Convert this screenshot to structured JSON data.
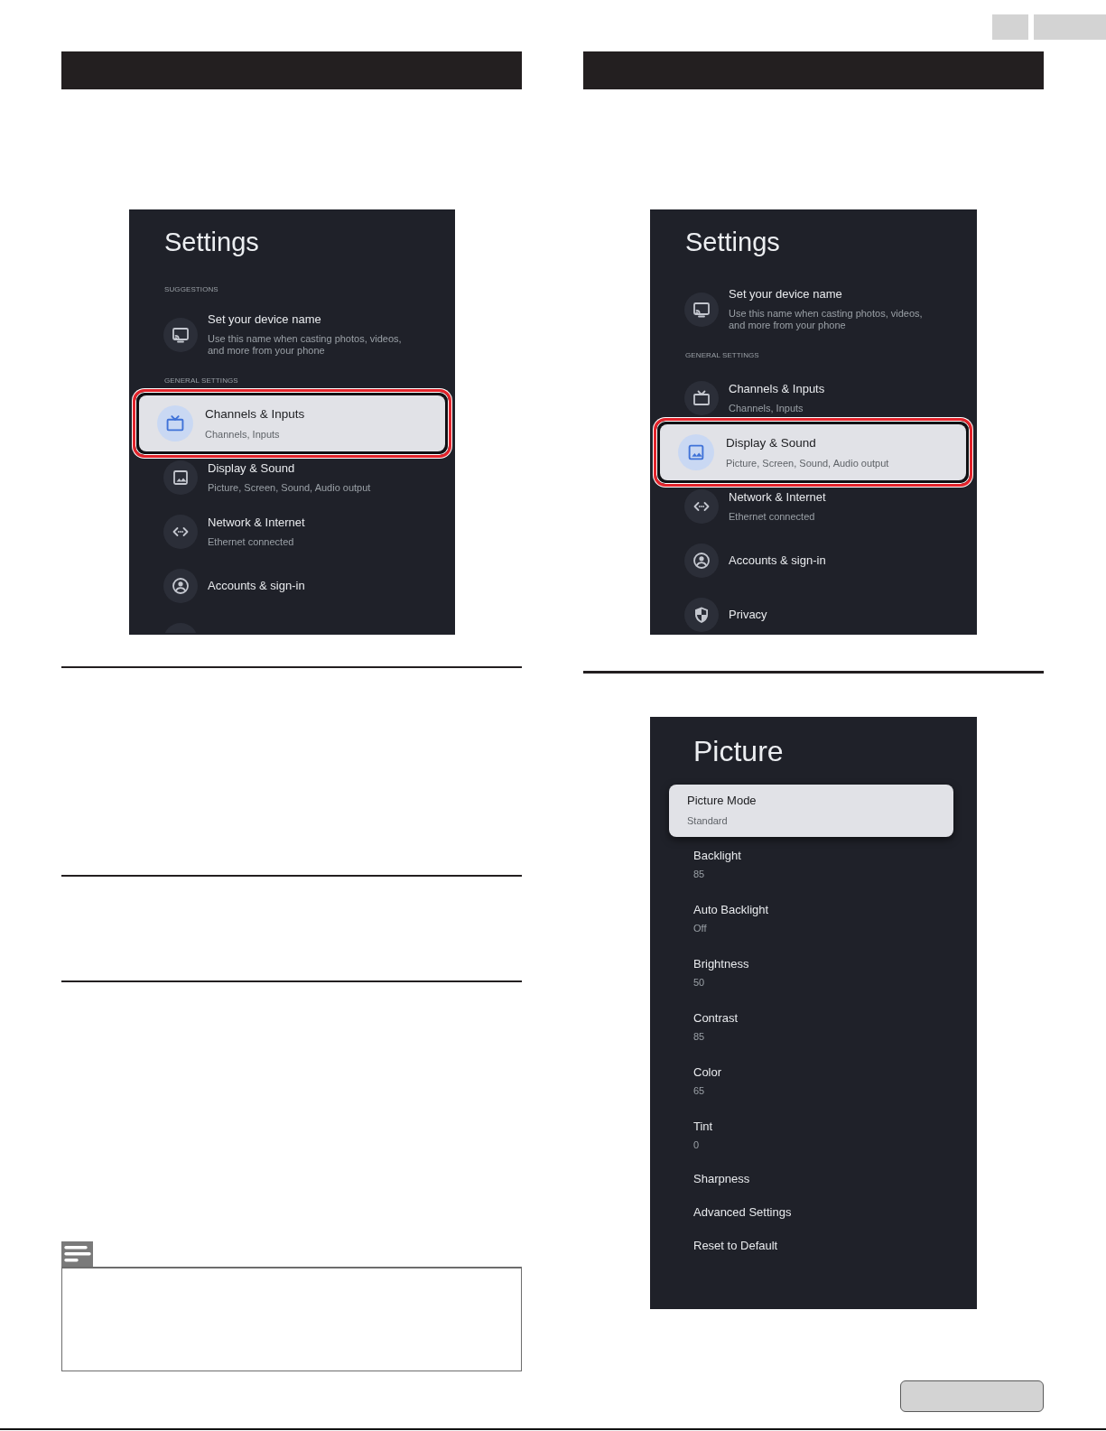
{
  "left_column": {
    "settings_screen": {
      "title": "Settings",
      "sections": [
        {
          "header": "SUGGESTIONS",
          "items": [
            {
              "kind": "cast",
              "title": "Set your device name",
              "subtitle": "Use this name when casting photos, videos, and more from your phone",
              "selected": false
            }
          ]
        },
        {
          "header": "GENERAL SETTINGS",
          "items": [
            {
              "kind": "tv",
              "title": "Channels & Inputs",
              "subtitle": "Channels, Inputs",
              "selected": true
            },
            {
              "kind": "image",
              "title": "Display & Sound",
              "subtitle": "Picture, Screen, Sound, Audio output",
              "selected": false
            },
            {
              "kind": "network",
              "title": "Network & Internet",
              "subtitle": "Ethernet connected",
              "selected": false
            },
            {
              "kind": "account",
              "title": "Accounts & sign-in",
              "selected": false
            }
          ]
        }
      ],
      "more_below": true
    }
  },
  "right_column": {
    "settings_screen": {
      "title": "Settings",
      "sections": [
        {
          "items": [
            {
              "kind": "cast",
              "title": "Set your device name",
              "subtitle": "Use this name when casting photos, videos, and more from your phone",
              "selected": false
            }
          ]
        },
        {
          "header": "GENERAL SETTINGS",
          "items": [
            {
              "kind": "tv",
              "title": "Channels & Inputs",
              "subtitle": "Channels, Inputs",
              "selected": false
            },
            {
              "kind": "image",
              "title": "Display & Sound",
              "subtitle": "Picture, Screen, Sound, Audio output",
              "selected": true
            },
            {
              "kind": "network",
              "title": "Network & Internet",
              "subtitle": "Ethernet connected",
              "selected": false
            },
            {
              "kind": "account",
              "title": "Accounts & sign-in",
              "selected": false
            },
            {
              "kind": "privacy",
              "title": "Privacy",
              "selected": false
            }
          ]
        }
      ]
    },
    "picture_screen": {
      "title": "Picture",
      "items": [
        {
          "label": "Picture Mode",
          "value": "Standard",
          "selected": true
        },
        {
          "label": "Backlight",
          "value": "85",
          "selected": false
        },
        {
          "label": "Auto Backlight",
          "value": "Off",
          "selected": false
        },
        {
          "label": "Brightness",
          "value": "50",
          "selected": false
        },
        {
          "label": "Contrast",
          "value": "85",
          "selected": false
        },
        {
          "label": "Color",
          "value": "65",
          "selected": false
        },
        {
          "label": "Tint",
          "value": "0",
          "selected": false
        },
        {
          "label": "Sharpness",
          "selected": false
        },
        {
          "label": "Advanced Settings",
          "selected": false
        },
        {
          "label": "Reset to Default",
          "selected": false
        }
      ]
    }
  }
}
